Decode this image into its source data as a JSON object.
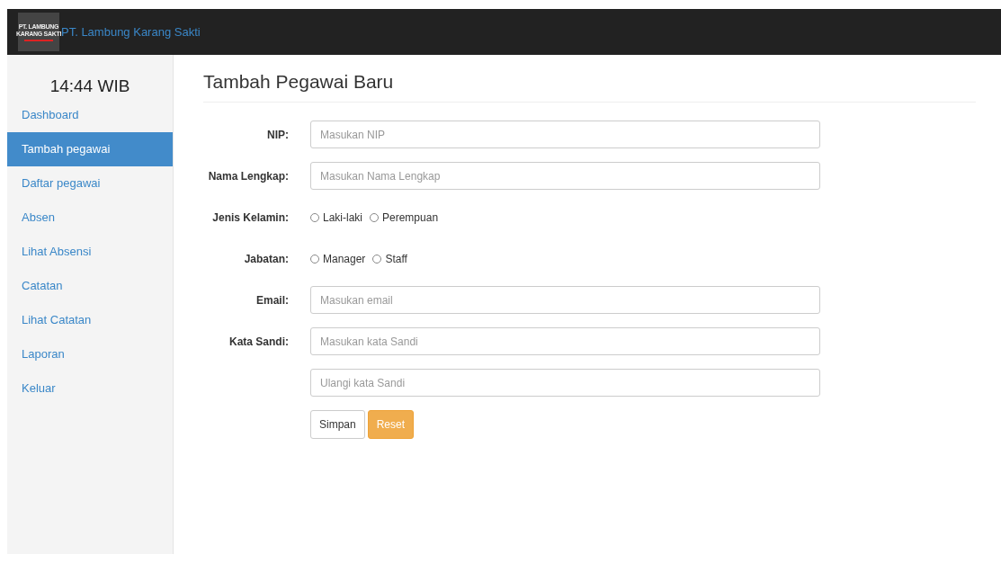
{
  "navbar": {
    "logo_lines": [
      "PT. LAMBUNG",
      "KARANG SAKTI"
    ],
    "brand": "PT. Lambung Karang Sakti"
  },
  "sidebar": {
    "clock": "14:44 WIB",
    "items": [
      {
        "label": "Dashboard",
        "selected": false
      },
      {
        "label": "Tambah pegawai",
        "selected": true
      },
      {
        "label": "Daftar pegawai",
        "selected": false
      },
      {
        "label": "Absen",
        "selected": false
      },
      {
        "label": "Lihat Absensi",
        "selected": false
      },
      {
        "label": "Catatan",
        "selected": false
      },
      {
        "label": "Lihat Catatan",
        "selected": false
      },
      {
        "label": "Laporan",
        "selected": false
      },
      {
        "label": "Keluar",
        "selected": false
      }
    ]
  },
  "title": "Tambah Pegawai Baru",
  "form": [
    {
      "kind": "text",
      "label": "NIP:",
      "placeholder": "Masukan NIP"
    },
    {
      "kind": "text",
      "label": "Nama Lengkap:",
      "placeholder": "Masukan Nama Lengkap"
    },
    {
      "kind": "radio",
      "label": "Jenis Kelamin:",
      "options": [
        {
          "label": "Laki-laki",
          "selected": false
        },
        {
          "label": "Perempuan",
          "selected": false
        }
      ]
    },
    {
      "kind": "radio",
      "label": "Jabatan:",
      "options": [
        {
          "label": "Manager",
          "selected": false
        },
        {
          "label": "Staff",
          "selected": false
        }
      ]
    },
    {
      "kind": "text",
      "label": "Email:",
      "placeholder": "Masukan email"
    },
    {
      "kind": "text",
      "label": "Kata Sandi:",
      "placeholder": "Masukan kata Sandi"
    },
    {
      "kind": "text",
      "placeholder": "Ulangi kata Sandi"
    }
  ],
  "buttons": [
    {
      "kind": "default",
      "label": "Simpan"
    },
    {
      "kind": "warning",
      "label": "Reset"
    }
  ]
}
